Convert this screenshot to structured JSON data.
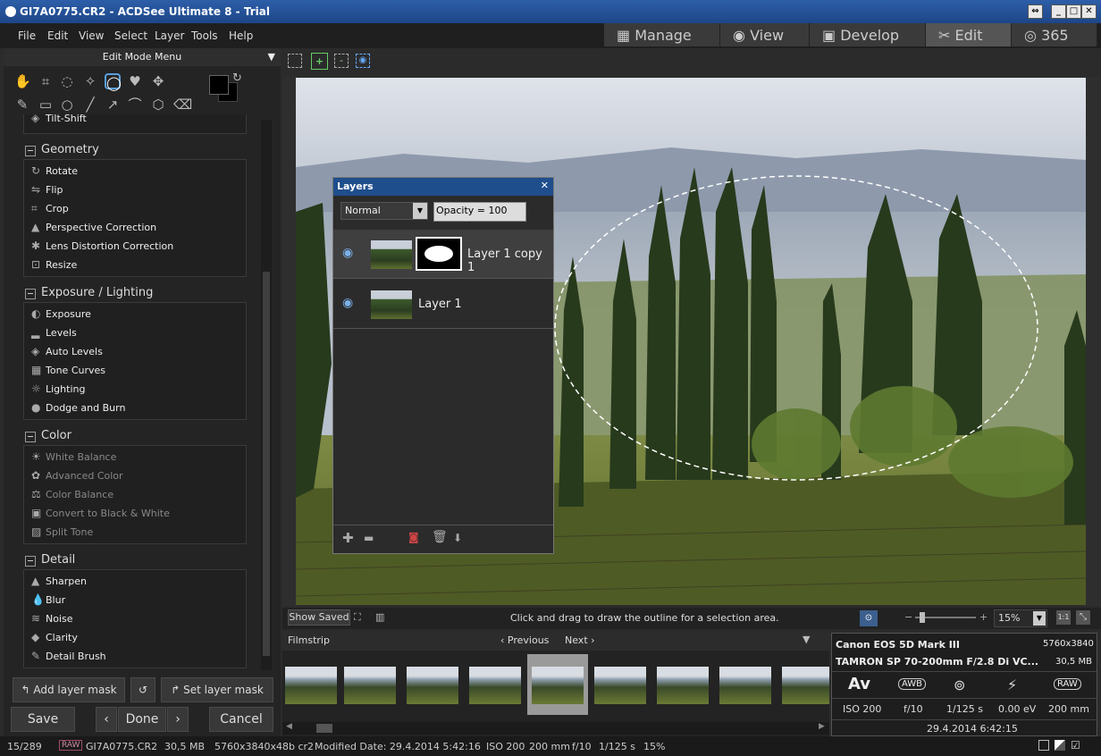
{
  "window": {
    "title": "GI7A0775.CR2 - ACDSee Ultimate 8 - Trial"
  },
  "menu": [
    "File",
    "Edit",
    "View",
    "Select",
    "Layer",
    "Tools",
    "Help"
  ],
  "modes": [
    {
      "label": "Manage",
      "icon": "grid-icon"
    },
    {
      "label": "View",
      "icon": "eye-icon"
    },
    {
      "label": "Develop",
      "icon": "photo-icon"
    },
    {
      "label": "Edit",
      "icon": "tools-icon"
    },
    {
      "label": "365",
      "icon": "365-icon"
    }
  ],
  "left": {
    "header": "Edit Mode Menu",
    "partial_item": "Tilt-Shift",
    "sections": [
      {
        "title": "Geometry",
        "items": [
          {
            "label": "Rotate",
            "icon": "rotate-icon",
            "enabled": true
          },
          {
            "label": "Flip",
            "icon": "flip-icon",
            "enabled": true
          },
          {
            "label": "Crop",
            "icon": "crop-icon",
            "enabled": true
          },
          {
            "label": "Perspective Correction",
            "icon": "perspective-icon",
            "enabled": true
          },
          {
            "label": "Lens Distortion Correction",
            "icon": "lens-icon",
            "enabled": true
          },
          {
            "label": "Resize",
            "icon": "resize-icon",
            "enabled": true
          }
        ]
      },
      {
        "title": "Exposure / Lighting",
        "items": [
          {
            "label": "Exposure",
            "icon": "exposure-icon",
            "enabled": true
          },
          {
            "label": "Levels",
            "icon": "levels-icon",
            "enabled": true
          },
          {
            "label": "Auto Levels",
            "icon": "auto-levels-icon",
            "enabled": true
          },
          {
            "label": "Tone Curves",
            "icon": "tone-curves-icon",
            "enabled": true
          },
          {
            "label": "Lighting",
            "icon": "lighting-icon",
            "enabled": true
          },
          {
            "label": "Dodge and Burn",
            "icon": "dodge-burn-icon",
            "enabled": true
          }
        ]
      },
      {
        "title": "Color",
        "items": [
          {
            "label": "White Balance",
            "icon": "white-balance-icon",
            "enabled": false
          },
          {
            "label": "Advanced Color",
            "icon": "advanced-color-icon",
            "enabled": false
          },
          {
            "label": "Color Balance",
            "icon": "color-balance-icon",
            "enabled": false
          },
          {
            "label": "Convert to Black & White",
            "icon": "bw-icon",
            "enabled": false
          },
          {
            "label": "Split Tone",
            "icon": "split-tone-icon",
            "enabled": false
          }
        ]
      },
      {
        "title": "Detail",
        "items": [
          {
            "label": "Sharpen",
            "icon": "sharpen-icon",
            "enabled": true
          },
          {
            "label": "Blur",
            "icon": "blur-icon",
            "enabled": true
          },
          {
            "label": "Noise",
            "icon": "noise-icon",
            "enabled": true
          },
          {
            "label": "Clarity",
            "icon": "clarity-icon",
            "enabled": true
          },
          {
            "label": "Detail Brush",
            "icon": "detail-brush-icon",
            "enabled": true
          }
        ]
      }
    ],
    "add_mask": "Add layer mask",
    "set_mask": "Set layer mask",
    "save": "Save",
    "done": "Done",
    "cancel": "Cancel"
  },
  "layers": {
    "title": "Layers",
    "blend": "Normal",
    "opacity": "Opacity = 100",
    "rows": [
      {
        "name": "Layer 1 copy 1",
        "has_mask": true
      },
      {
        "name": "Layer 1",
        "has_mask": false
      }
    ]
  },
  "canvas": {
    "show_saved": "Show Saved",
    "hint": "Click and drag to draw the outline for a selection area.",
    "zoom": "15%",
    "zoom_ratio": "1:1"
  },
  "filmstrip": {
    "title": "Filmstrip",
    "previous": "Previous",
    "next": "Next",
    "count": 9,
    "selected_index": 4
  },
  "info": {
    "camera": "Canon EOS 5D Mark III",
    "dimensions": "5760x3840",
    "lens": "TAMRON SP 70-200mm F/2.8 Di VC...",
    "size": "30,5 MB",
    "badges": [
      "Av",
      "AWB",
      "",
      "",
      "RAW"
    ],
    "iso": "ISO 200",
    "aperture": "f/10",
    "shutter": "1/125 s",
    "ev": "0.00 eV",
    "focal": "200 mm",
    "date": "29.4.2014 6:42:15"
  },
  "status": {
    "index": "15/289",
    "raw": "RAW",
    "filename": "GI7A0775.CR2",
    "size": "30,5 MB",
    "dims": "5760x3840x48b cr2",
    "modified": "Modified Date: 29.4.2014 5:42:16",
    "iso": "ISO 200",
    "focal": "200 mm",
    "aperture": "f/10",
    "shutter": "1/125 s",
    "zoom": "15%"
  }
}
